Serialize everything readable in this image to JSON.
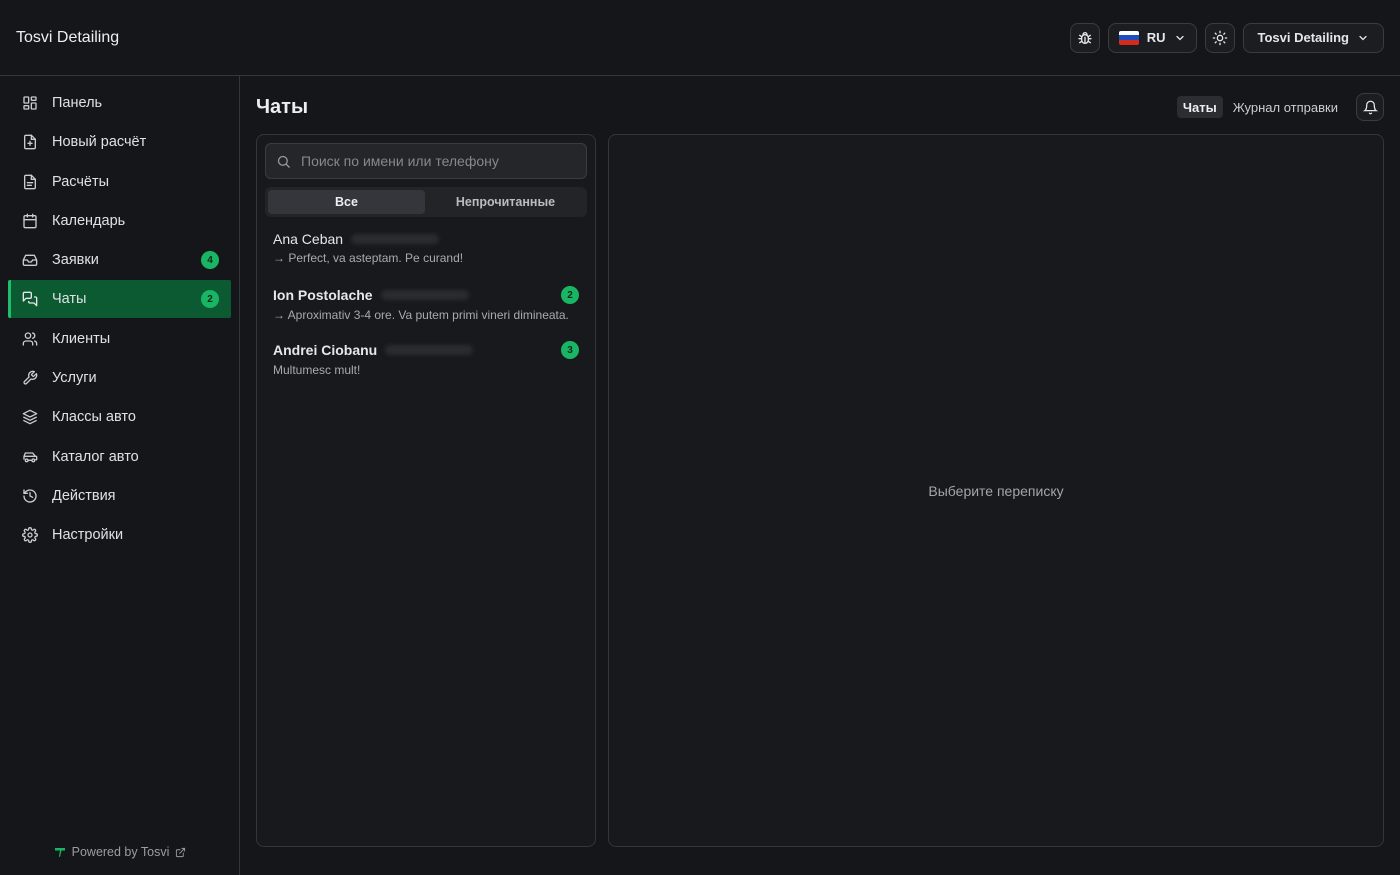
{
  "app": {
    "brand": "Tosvi Detailing",
    "language": "RU",
    "account": "Tosvi Detailing",
    "powered_by": "Powered by Tosvi"
  },
  "colors": {
    "accent": "#19b565",
    "active_bg": "#0c5a31",
    "flag": [
      "#ffffff",
      "#1f4fbf",
      "#d52b1e"
    ]
  },
  "sidebar": {
    "items": [
      {
        "label": "Панель",
        "icon": "dashboard-icon"
      },
      {
        "label": "Новый расчёт",
        "icon": "file-plus-icon"
      },
      {
        "label": "Расчёты",
        "icon": "file-text-icon"
      },
      {
        "label": "Календарь",
        "icon": "calendar-icon"
      },
      {
        "label": "Заявки",
        "icon": "inbox-icon",
        "badge": "4"
      },
      {
        "label": "Чаты",
        "icon": "chat-icon",
        "badge": "2",
        "active": true
      },
      {
        "label": "Клиенты",
        "icon": "users-icon"
      },
      {
        "label": "Услуги",
        "icon": "wrench-icon"
      },
      {
        "label": "Классы авто",
        "icon": "layers-icon"
      },
      {
        "label": "Каталог авто",
        "icon": "car-icon"
      },
      {
        "label": "Действия",
        "icon": "history-icon"
      },
      {
        "label": "Настройки",
        "icon": "gear-icon"
      }
    ]
  },
  "main": {
    "title": "Чаты",
    "tabs": [
      "Чаты",
      "Журнал отправки"
    ],
    "search_placeholder": "Поиск по имени или телефону",
    "filters": [
      "Все",
      "Непрочитанные"
    ],
    "chats": [
      {
        "name": "Ana Ceban",
        "preview": "→ Perfect, va asteptam. Pe curand!",
        "unread": ""
      },
      {
        "name": "Ion Postolache",
        "preview": "→ Aproximativ 3-4 ore. Va putem primi vineri dimineata.",
        "unread": "2"
      },
      {
        "name": "Andrei Ciobanu",
        "preview": "Multumesc mult!",
        "unread": "3"
      }
    ],
    "empty_state": "Выберите переписку"
  }
}
